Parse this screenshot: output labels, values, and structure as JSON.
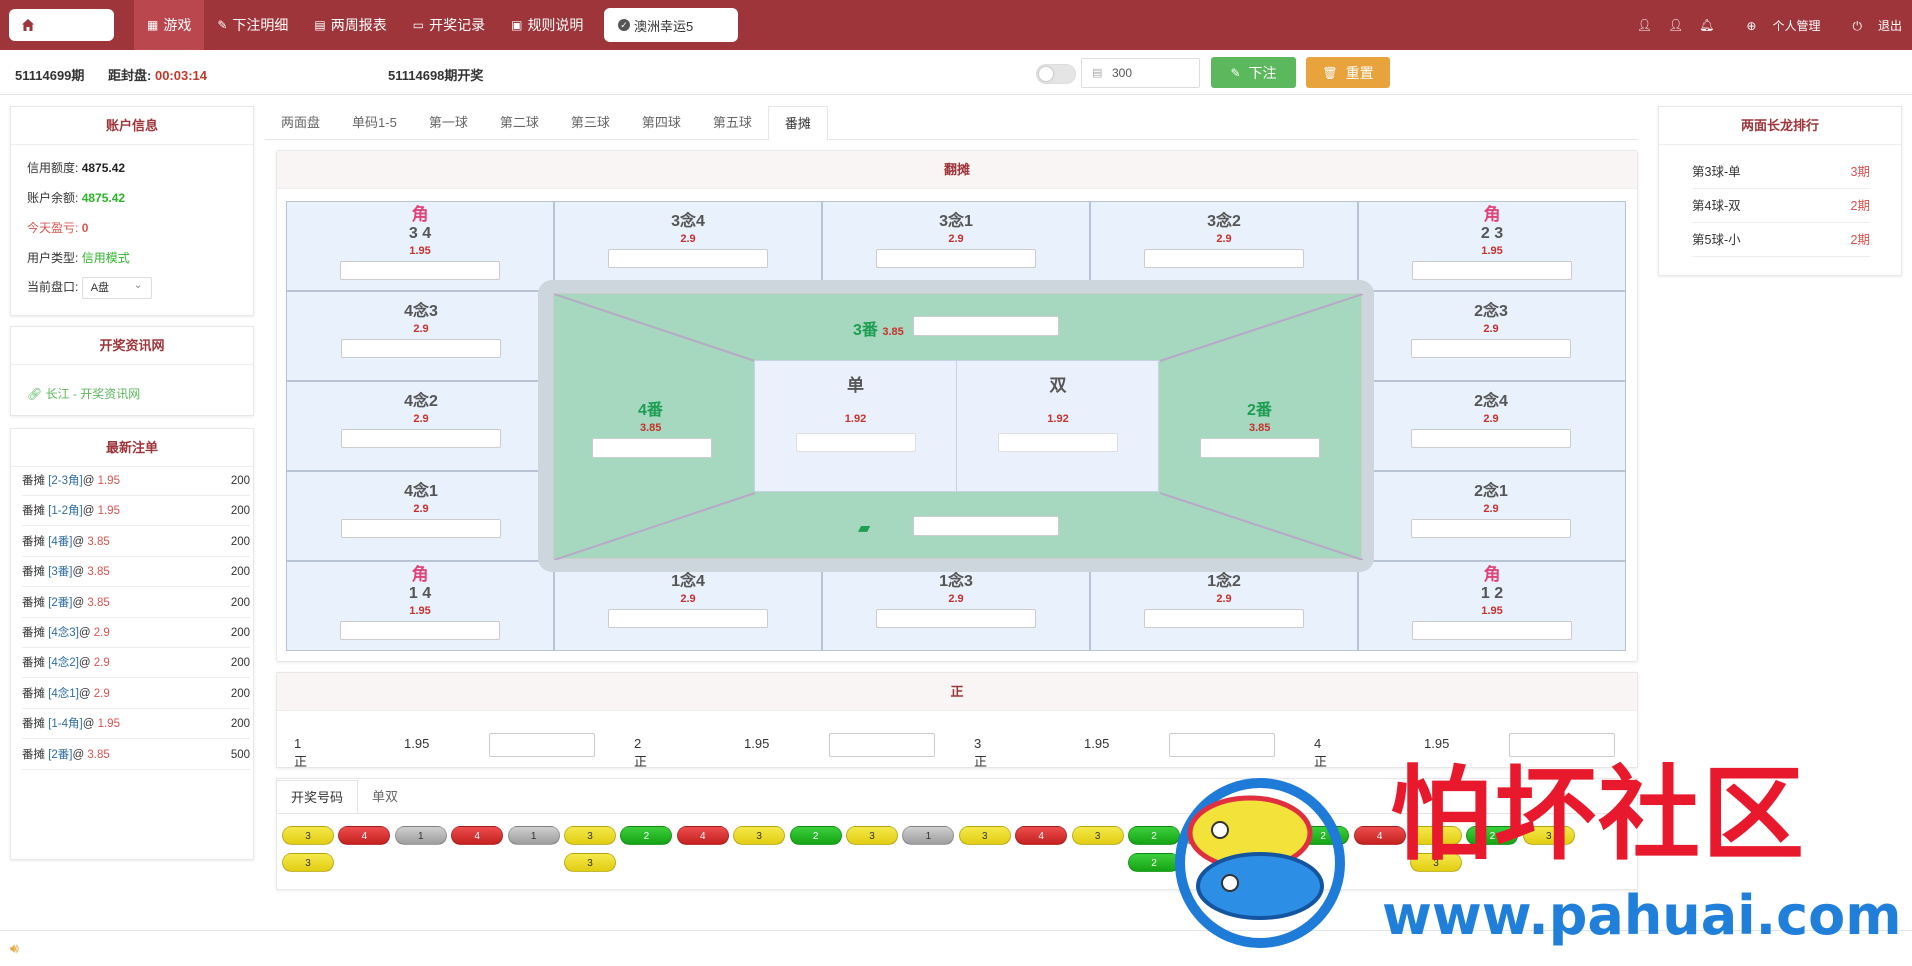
{
  "topnav": {
    "items": [
      {
        "label": "游戏",
        "icon": "grid-icon",
        "active": true
      },
      {
        "label": "下注明细",
        "icon": "pencil-icon",
        "active": false
      },
      {
        "label": "两周报表",
        "icon": "table-icon",
        "active": false
      },
      {
        "label": "开奖记录",
        "icon": "monitor-icon",
        "active": false
      },
      {
        "label": "规则说明",
        "icon": "message-icon",
        "active": false
      }
    ],
    "game_tab": "澳洲幸运5",
    "right": {
      "manage": "个人管理",
      "logout": "退出"
    }
  },
  "subbar": {
    "period": "51114699期",
    "close_label": "距封盘:",
    "countdown": "00:03:14",
    "last_draw": "51114698期开奖",
    "amount": "300",
    "bet_label": "下注",
    "reset_label": "重置"
  },
  "account": {
    "title": "账户信息",
    "credit_label": "信用额度:",
    "credit": "4875.42",
    "balance_label": "账户余额:",
    "balance": "4875.42",
    "profit_label": "今天盈亏:",
    "profit": "0",
    "type_label": "用户类型:",
    "type": "信用模式",
    "plate_label": "当前盘口:",
    "plate": "A盘"
  },
  "info_site": {
    "title": "开奖资讯网",
    "link": "长江 - 开奖资讯网"
  },
  "recent": {
    "title": "最新注单",
    "orders": [
      {
        "pre": "番摊 ",
        "link": "[2-3角]",
        "at": "@ ",
        "odd": "1.95",
        "amt": "200"
      },
      {
        "pre": "番摊 ",
        "link": "[1-2角]",
        "at": "@ ",
        "odd": "1.95",
        "amt": "200"
      },
      {
        "pre": "番摊 ",
        "link": "[4番]",
        "at": "@ ",
        "odd": "3.85",
        "amt": "200"
      },
      {
        "pre": "番摊 ",
        "link": "[3番]",
        "at": "@ ",
        "odd": "3.85",
        "amt": "200"
      },
      {
        "pre": "番摊 ",
        "link": "[2番]",
        "at": "@ ",
        "odd": "3.85",
        "amt": "200"
      },
      {
        "pre": "番摊 ",
        "link": "[4念3]",
        "at": "@ ",
        "odd": "2.9",
        "amt": "200"
      },
      {
        "pre": "番摊 ",
        "link": "[4念2]",
        "at": "@ ",
        "odd": "2.9",
        "amt": "200"
      },
      {
        "pre": "番摊 ",
        "link": "[4念1]",
        "at": "@ ",
        "odd": "2.9",
        "amt": "200"
      },
      {
        "pre": "番摊 ",
        "link": "[1-4角]",
        "at": "@ ",
        "odd": "1.95",
        "amt": "200"
      },
      {
        "pre": "番摊 ",
        "link": "[2番]",
        "at": "@ ",
        "odd": "3.85",
        "amt": "500"
      }
    ]
  },
  "tabs": [
    "两面盘",
    "单码1-5",
    "第一球",
    "第二球",
    "第三球",
    "第四球",
    "第五球",
    "番摊"
  ],
  "fantan": {
    "title": "翻摊",
    "top": [
      {
        "corner": "角",
        "name": "3 4",
        "odd": "1.95"
      },
      {
        "corner": "",
        "name": "3念4",
        "odd": "2.9"
      },
      {
        "corner": "",
        "name": "3念1",
        "odd": "2.9"
      },
      {
        "corner": "",
        "name": "3念2",
        "odd": "2.9"
      },
      {
        "corner": "角",
        "name": "2 3",
        "odd": "1.95"
      }
    ],
    "left": [
      {
        "name": "4念3",
        "odd": "2.9"
      },
      {
        "name": "4念2",
        "odd": "2.9"
      },
      {
        "name": "4念1",
        "odd": "2.9"
      }
    ],
    "right": [
      {
        "name": "2念3",
        "odd": "2.9"
      },
      {
        "name": "2念4",
        "odd": "2.9"
      },
      {
        "name": "2念1",
        "odd": "2.9"
      }
    ],
    "bottom": [
      {
        "corner": "角",
        "name": "1 4",
        "odd": "1.95"
      },
      {
        "corner": "",
        "name": "1念4",
        "odd": "2.9"
      },
      {
        "corner": "",
        "name": "1念3",
        "odd": "2.9"
      },
      {
        "corner": "",
        "name": "1念2",
        "odd": "2.9"
      },
      {
        "corner": "角",
        "name": "1 2",
        "odd": "1.95"
      }
    ],
    "fan3": {
      "name": "3番",
      "odd": "3.85"
    },
    "fan4": {
      "name": "4番",
      "odd": "3.85"
    },
    "fan2": {
      "name": "2番",
      "odd": "3.85"
    },
    "dan": {
      "name": "单",
      "odd": "1.92"
    },
    "shuang": {
      "name": "双",
      "odd": "1.92"
    }
  },
  "zheng": {
    "title": "正",
    "items": [
      {
        "name": "1正",
        "odd": "1.95"
      },
      {
        "name": "2正",
        "odd": "1.95"
      },
      {
        "name": "3正",
        "odd": "1.95"
      },
      {
        "name": "4正",
        "odd": "1.95"
      }
    ]
  },
  "results": {
    "tabs": [
      "开奖号码",
      "单双"
    ],
    "row1": [
      {
        "v": "3",
        "c": "y"
      },
      {
        "v": "4",
        "c": "r"
      },
      {
        "v": "1",
        "c": "gr"
      },
      {
        "v": "4",
        "c": "r"
      },
      {
        "v": "1",
        "c": "gr"
      },
      {
        "v": "3",
        "c": "y"
      },
      {
        "v": "2",
        "c": "g"
      },
      {
        "v": "4",
        "c": "r"
      },
      {
        "v": "3",
        "c": "y"
      },
      {
        "v": "2",
        "c": "g"
      },
      {
        "v": "3",
        "c": "y"
      },
      {
        "v": "1",
        "c": "gr"
      },
      {
        "v": "3",
        "c": "y"
      },
      {
        "v": "4",
        "c": "r"
      },
      {
        "v": "3",
        "c": "y"
      },
      {
        "v": "2",
        "c": "g"
      },
      {
        "v": "1",
        "c": "gr"
      },
      {
        "v": "4",
        "c": "r"
      },
      {
        "v": "2",
        "c": "g"
      },
      {
        "v": "4",
        "c": "r"
      },
      {
        "v": "3",
        "c": "y"
      },
      {
        "v": "2",
        "c": "g"
      },
      {
        "v": "3",
        "c": "y"
      }
    ],
    "row2": [
      {
        "col": 0,
        "v": "3",
        "c": "y"
      },
      {
        "col": 5,
        "v": "3",
        "c": "y"
      },
      {
        "col": 15,
        "v": "2",
        "c": "g"
      },
      {
        "col": 20,
        "v": "3",
        "c": "y"
      }
    ]
  },
  "ranking": {
    "title": "两面长龙排行",
    "rows": [
      {
        "name": "第3球-单",
        "periods": "3期"
      },
      {
        "name": "第4球-双",
        "periods": "2期"
      },
      {
        "name": "第5球-小",
        "periods": "2期"
      }
    ]
  },
  "watermark": {
    "cn": "怕坏社区",
    "url": "www.pahuai.com"
  }
}
